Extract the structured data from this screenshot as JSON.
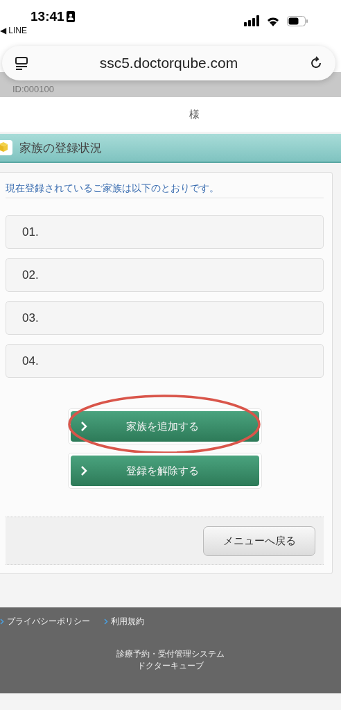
{
  "status_bar": {
    "time": "13:41",
    "back_app": "◀ LINE"
  },
  "browser": {
    "url": "ssc5.doctorqube.com"
  },
  "account": {
    "id": "ID:000100",
    "honorific": "様"
  },
  "section": {
    "title": "家族の登録状況"
  },
  "panel": {
    "intro": "現在登録されているご家族は以下のとおりです。",
    "members": [
      {
        "number": "01."
      },
      {
        "number": "02."
      },
      {
        "number": "03."
      },
      {
        "number": "04."
      }
    ],
    "actions": [
      {
        "label": "家族を追加する",
        "highlighted": true
      },
      {
        "label": "登録を解除する",
        "highlighted": false
      }
    ],
    "back_button": "メニューへ戻る"
  },
  "footer": {
    "links": [
      "プライバシーポリシー",
      "利用規約"
    ],
    "system_name": "診療予約・受付管理システム",
    "product_name": "ドクターキューブ"
  }
}
